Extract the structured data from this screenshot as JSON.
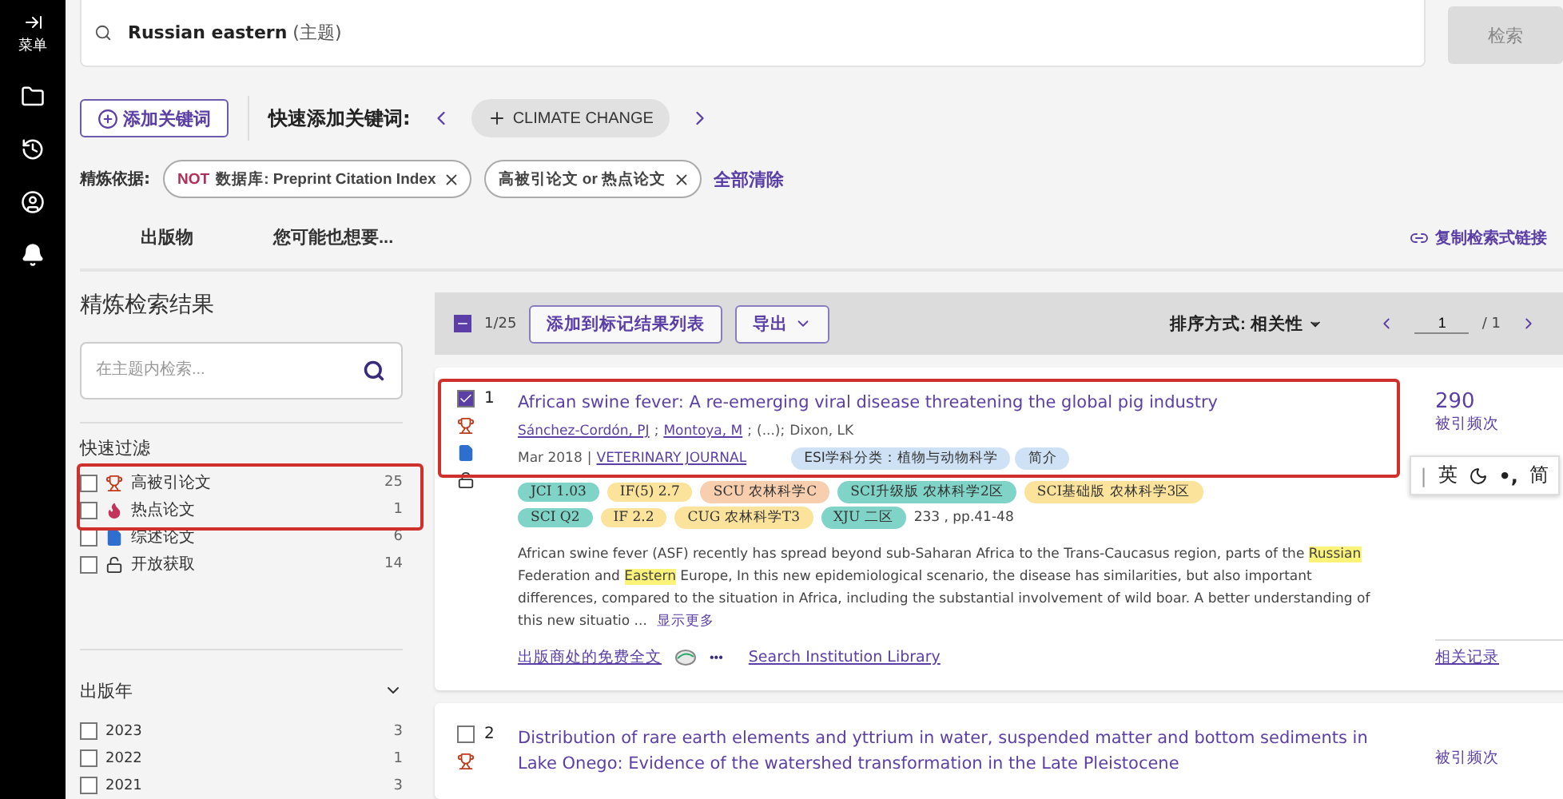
{
  "sidebar": {
    "menu_label": "菜单"
  },
  "search": {
    "query": "Russian eastern",
    "field": "(主题)",
    "button": "检索"
  },
  "keywords": {
    "add_button": "添加关键词",
    "quick_label": "快速添加关键词:",
    "suggestion": "CLIMATE CHANGE"
  },
  "refine": {
    "label": "精炼依据:",
    "chips": [
      {
        "prefix": "NOT",
        "text": "数据库: Preprint Citation Index"
      },
      {
        "text": "高被引论文 or 热点论文"
      }
    ],
    "clear": "全部清除"
  },
  "tabs": [
    {
      "label": "出版物",
      "selected": false
    },
    {
      "label": "您可能也想要...",
      "selected": false
    }
  ],
  "copy_link": "复制检索式链接",
  "filters": {
    "title": "精炼检索结果",
    "search_placeholder": "在主题内检索...",
    "quick_title": "快速过滤",
    "quick": [
      {
        "kind": "trophy",
        "label": "高被引论文",
        "count": "25",
        "checked": false,
        "annotated": true
      },
      {
        "kind": "flame",
        "label": "热点论文",
        "count": "1",
        "checked": false,
        "annotated": true
      },
      {
        "kind": "doc",
        "label": "综述论文",
        "count": "6",
        "checked": false,
        "annotated": false
      },
      {
        "kind": "lock",
        "label": "开放获取",
        "count": "14",
        "checked": false,
        "annotated": false
      }
    ],
    "year_title": "出版年",
    "expanded": true,
    "years": [
      {
        "label": "2023",
        "count": "3",
        "checked": false
      },
      {
        "label": "2022",
        "count": "1",
        "checked": false
      },
      {
        "label": "2021",
        "count": "3",
        "checked": false
      }
    ]
  },
  "toolbar": {
    "partially_selected": true,
    "selected_count": "1/25",
    "add_button": "添加到标记结果列表",
    "export": "导出",
    "sort": "排序方式: 相关性",
    "page": "1",
    "pages": "/ 1"
  },
  "records": [
    {
      "number": "1",
      "checked": true,
      "annotated": true,
      "highly_cited": true,
      "review": true,
      "open_access": true,
      "title": "African swine fever: A re-emerging viral disease threatening the global pig industry",
      "authors": [
        "Sánchez-Cordón, PJ",
        ";",
        "Montoya, M",
        ";",
        "(...);",
        "Dixon, LK"
      ],
      "date": "Mar 2018",
      "separator": "|",
      "journal": "VETERINARY JOURNAL",
      "badges": [
        {
          "text": "ESI学科分类：植物与动物科学",
          "color": "#cfe2f5"
        },
        {
          "text": "简介",
          "color": "#cfe2f5"
        }
      ],
      "tags": [
        {
          "text": "JCI 1.03",
          "color": "#7fd3c7"
        },
        {
          "text": "IF(5) 2.7",
          "color": "#fbe39c"
        },
        {
          "text": "SCU 农林科学C",
          "color": "#f8cfae"
        },
        {
          "text": "SCI升级版 农林科学2区",
          "color": "#7fd3c7"
        },
        {
          "text": "SCI基础版 农林科学3区",
          "color": "#fbe39c"
        },
        {
          "text": "SCI Q2",
          "color": "#7fd3c7"
        },
        {
          "text": "IF 2.2",
          "color": "#fbe39c"
        },
        {
          "text": "CUG 农林科学T3",
          "color": "#fbe39c"
        },
        {
          "text": "XJU 二区",
          "color": "#7fd3c7"
        }
      ],
      "pages": "233 , pp.41-48",
      "abstract": [
        {
          "text": "African swine fever (ASF) recently has spread beyond sub-Saharan Africa to the Trans-Caucasus region, parts of the ",
          "highlight": false
        },
        {
          "text": "Russian",
          "highlight": true
        },
        {
          "text": " Federation and ",
          "highlight": false
        },
        {
          "text": "Eastern",
          "highlight": true
        },
        {
          "text": " Europe, In this new epidemiological scenario, the disease has similarities, but also important differences, compared to the situation in Africa, including the substantial involvement of wild boar. A better understanding of this new situatio ...",
          "highlight": false
        }
      ],
      "show_more": "显示更多",
      "free_text": "出版商处的免费全文",
      "more": "•••",
      "library": "Search Institution Library",
      "citations": "290",
      "citations_label": "被引频次",
      "related": "相关记录"
    },
    {
      "number": "2",
      "checked": false,
      "annotated": false,
      "highly_cited": true,
      "review": false,
      "open_access": false,
      "title": "Distribution of rare earth elements and yttrium in water, suspended matter and bottom sediments in Lake Onego: Evidence of the watershed transformation in the Late Pleistocene",
      "citations_label": "被引频次"
    }
  ],
  "ime": {
    "cursor": "|",
    "mode": "英",
    "punct": "•,",
    "script": "简"
  }
}
